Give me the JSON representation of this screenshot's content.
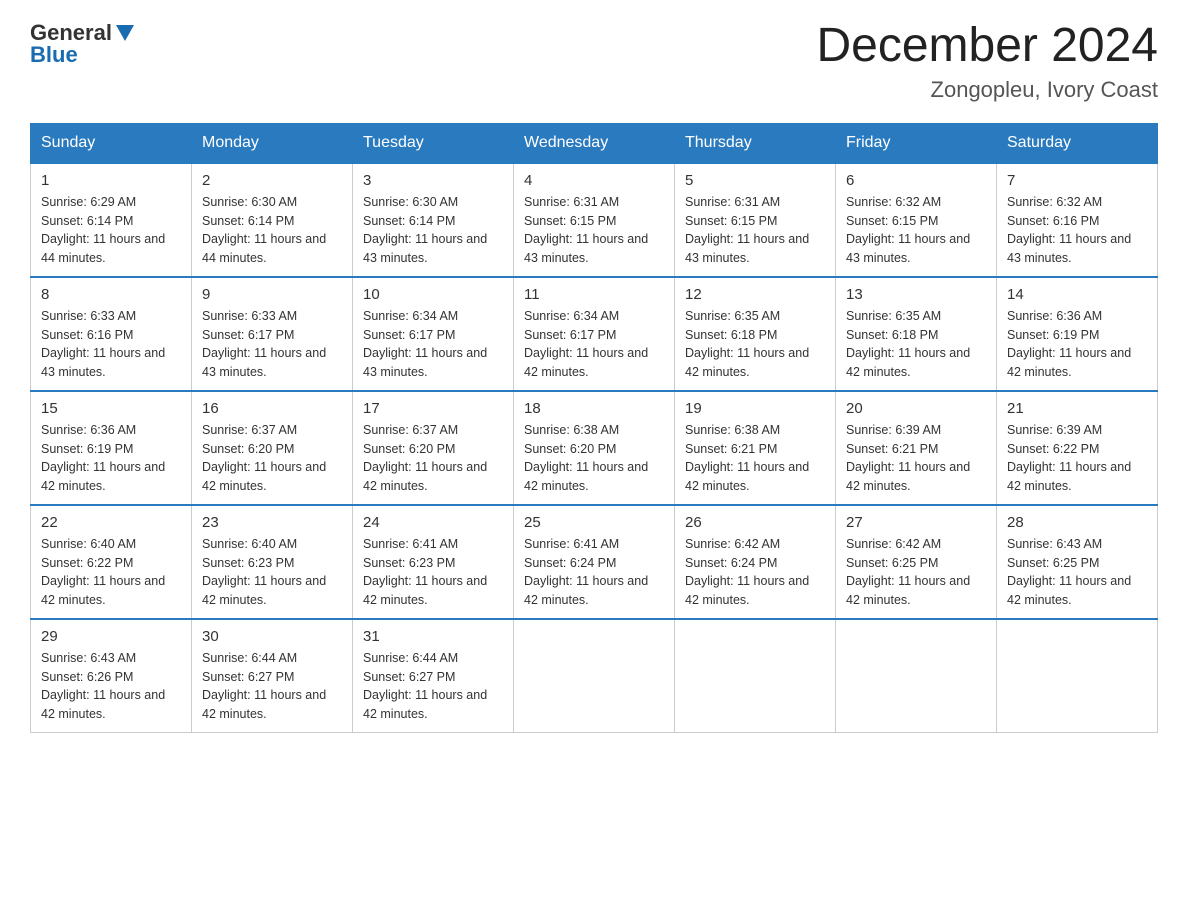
{
  "header": {
    "logo_general": "General",
    "logo_blue": "Blue",
    "month_title": "December 2024",
    "location": "Zongopleu, Ivory Coast"
  },
  "days_of_week": [
    "Sunday",
    "Monday",
    "Tuesday",
    "Wednesday",
    "Thursday",
    "Friday",
    "Saturday"
  ],
  "weeks": [
    [
      {
        "day": "1",
        "sunrise": "6:29 AM",
        "sunset": "6:14 PM",
        "daylight": "11 hours and 44 minutes."
      },
      {
        "day": "2",
        "sunrise": "6:30 AM",
        "sunset": "6:14 PM",
        "daylight": "11 hours and 44 minutes."
      },
      {
        "day": "3",
        "sunrise": "6:30 AM",
        "sunset": "6:14 PM",
        "daylight": "11 hours and 43 minutes."
      },
      {
        "day": "4",
        "sunrise": "6:31 AM",
        "sunset": "6:15 PM",
        "daylight": "11 hours and 43 minutes."
      },
      {
        "day": "5",
        "sunrise": "6:31 AM",
        "sunset": "6:15 PM",
        "daylight": "11 hours and 43 minutes."
      },
      {
        "day": "6",
        "sunrise": "6:32 AM",
        "sunset": "6:15 PM",
        "daylight": "11 hours and 43 minutes."
      },
      {
        "day": "7",
        "sunrise": "6:32 AM",
        "sunset": "6:16 PM",
        "daylight": "11 hours and 43 minutes."
      }
    ],
    [
      {
        "day": "8",
        "sunrise": "6:33 AM",
        "sunset": "6:16 PM",
        "daylight": "11 hours and 43 minutes."
      },
      {
        "day": "9",
        "sunrise": "6:33 AM",
        "sunset": "6:17 PM",
        "daylight": "11 hours and 43 minutes."
      },
      {
        "day": "10",
        "sunrise": "6:34 AM",
        "sunset": "6:17 PM",
        "daylight": "11 hours and 43 minutes."
      },
      {
        "day": "11",
        "sunrise": "6:34 AM",
        "sunset": "6:17 PM",
        "daylight": "11 hours and 42 minutes."
      },
      {
        "day": "12",
        "sunrise": "6:35 AM",
        "sunset": "6:18 PM",
        "daylight": "11 hours and 42 minutes."
      },
      {
        "day": "13",
        "sunrise": "6:35 AM",
        "sunset": "6:18 PM",
        "daylight": "11 hours and 42 minutes."
      },
      {
        "day": "14",
        "sunrise": "6:36 AM",
        "sunset": "6:19 PM",
        "daylight": "11 hours and 42 minutes."
      }
    ],
    [
      {
        "day": "15",
        "sunrise": "6:36 AM",
        "sunset": "6:19 PM",
        "daylight": "11 hours and 42 minutes."
      },
      {
        "day": "16",
        "sunrise": "6:37 AM",
        "sunset": "6:20 PM",
        "daylight": "11 hours and 42 minutes."
      },
      {
        "day": "17",
        "sunrise": "6:37 AM",
        "sunset": "6:20 PM",
        "daylight": "11 hours and 42 minutes."
      },
      {
        "day": "18",
        "sunrise": "6:38 AM",
        "sunset": "6:20 PM",
        "daylight": "11 hours and 42 minutes."
      },
      {
        "day": "19",
        "sunrise": "6:38 AM",
        "sunset": "6:21 PM",
        "daylight": "11 hours and 42 minutes."
      },
      {
        "day": "20",
        "sunrise": "6:39 AM",
        "sunset": "6:21 PM",
        "daylight": "11 hours and 42 minutes."
      },
      {
        "day": "21",
        "sunrise": "6:39 AM",
        "sunset": "6:22 PM",
        "daylight": "11 hours and 42 minutes."
      }
    ],
    [
      {
        "day": "22",
        "sunrise": "6:40 AM",
        "sunset": "6:22 PM",
        "daylight": "11 hours and 42 minutes."
      },
      {
        "day": "23",
        "sunrise": "6:40 AM",
        "sunset": "6:23 PM",
        "daylight": "11 hours and 42 minutes."
      },
      {
        "day": "24",
        "sunrise": "6:41 AM",
        "sunset": "6:23 PM",
        "daylight": "11 hours and 42 minutes."
      },
      {
        "day": "25",
        "sunrise": "6:41 AM",
        "sunset": "6:24 PM",
        "daylight": "11 hours and 42 minutes."
      },
      {
        "day": "26",
        "sunrise": "6:42 AM",
        "sunset": "6:24 PM",
        "daylight": "11 hours and 42 minutes."
      },
      {
        "day": "27",
        "sunrise": "6:42 AM",
        "sunset": "6:25 PM",
        "daylight": "11 hours and 42 minutes."
      },
      {
        "day": "28",
        "sunrise": "6:43 AM",
        "sunset": "6:25 PM",
        "daylight": "11 hours and 42 minutes."
      }
    ],
    [
      {
        "day": "29",
        "sunrise": "6:43 AM",
        "sunset": "6:26 PM",
        "daylight": "11 hours and 42 minutes."
      },
      {
        "day": "30",
        "sunrise": "6:44 AM",
        "sunset": "6:27 PM",
        "daylight": "11 hours and 42 minutes."
      },
      {
        "day": "31",
        "sunrise": "6:44 AM",
        "sunset": "6:27 PM",
        "daylight": "11 hours and 42 minutes."
      },
      null,
      null,
      null,
      null
    ]
  ]
}
